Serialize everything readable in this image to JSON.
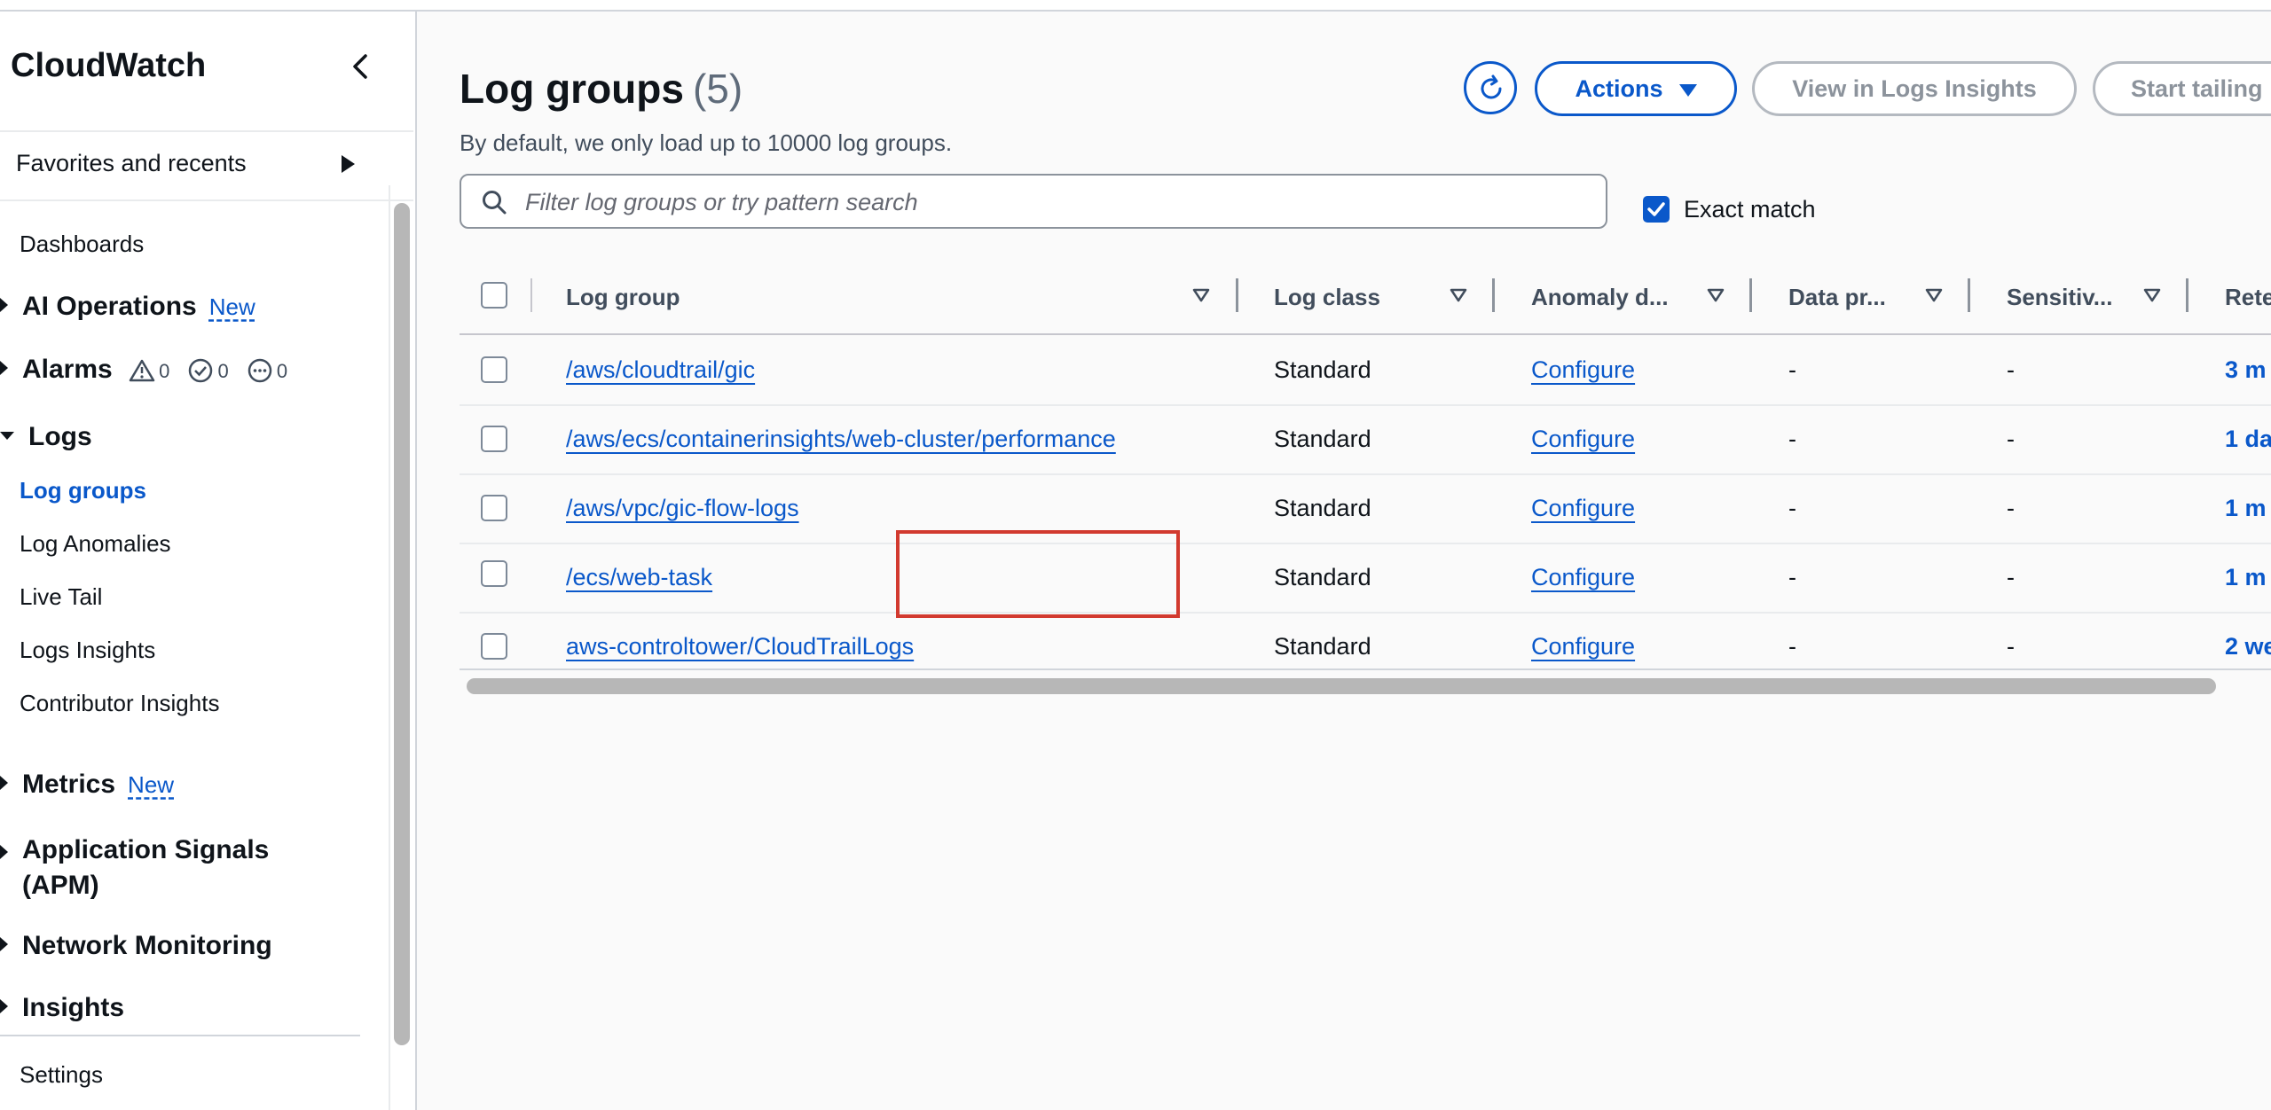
{
  "sidebar": {
    "title": "CloudWatch",
    "favorites_label": "Favorites and recents",
    "dashboards": "Dashboards",
    "ai_operations": "AI Operations",
    "ai_operations_badge": "New",
    "alarms": "Alarms",
    "alarm_counts": {
      "alarm": "0",
      "ok": "0",
      "insufficient": "0"
    },
    "logs": "Logs",
    "logs_items": [
      "Log groups",
      "Log Anomalies",
      "Live Tail",
      "Logs Insights",
      "Contributor Insights"
    ],
    "metrics": "Metrics",
    "metrics_badge": "New",
    "application_signals": "Application Signals (APM)",
    "network_monitoring": "Network Monitoring",
    "insights": "Insights",
    "settings": "Settings"
  },
  "header": {
    "title": "Log groups",
    "count": "(5)",
    "description": "By default, we only load up to 10000 log groups.",
    "actions_label": "Actions",
    "view_insights_label": "View in Logs Insights",
    "start_tailing_label": "Start tailing"
  },
  "search": {
    "placeholder": "Filter log groups or try pattern search",
    "exact_match_label": "Exact match",
    "exact_match_checked": true
  },
  "table": {
    "columns": [
      "Log group",
      "Log class",
      "Anomaly d...",
      "Data pr...",
      "Sensitiv...",
      "Rete"
    ],
    "rows": [
      {
        "log_group": "/aws/cloudtrail/gic",
        "log_class": "Standard",
        "anomaly": "Configure",
        "data_protection": "-",
        "sensitive": "-",
        "retention": "3 m"
      },
      {
        "log_group": "/aws/ecs/containerinsights/web-cluster/performance",
        "log_class": "Standard",
        "anomaly": "Configure",
        "data_protection": "-",
        "sensitive": "-",
        "retention": "1 da"
      },
      {
        "log_group": "/aws/vpc/gic-flow-logs",
        "log_class": "Standard",
        "anomaly": "Configure",
        "data_protection": "-",
        "sensitive": "-",
        "retention": "1 m"
      },
      {
        "log_group": "/ecs/web-task",
        "log_class": "Standard",
        "anomaly": "Configure",
        "data_protection": "-",
        "sensitive": "-",
        "retention": "1 m"
      },
      {
        "log_group": "aws-controltower/CloudTrailLogs",
        "log_class": "Standard",
        "anomaly": "Configure",
        "data_protection": "-",
        "sensitive": "-",
        "retention": "2 we"
      }
    ]
  },
  "colors": {
    "accent": "#0a58ca",
    "highlight": "#d23a2f",
    "disabled": "#8c939c"
  },
  "icons": [
    "chevron-left-icon",
    "play-triangle-icon",
    "refresh-icon",
    "caret-down-icon",
    "search-icon",
    "checkmark-icon",
    "sort-icon",
    "alarm-warning-icon",
    "ok-check-icon",
    "insufficient-dots-icon"
  ]
}
